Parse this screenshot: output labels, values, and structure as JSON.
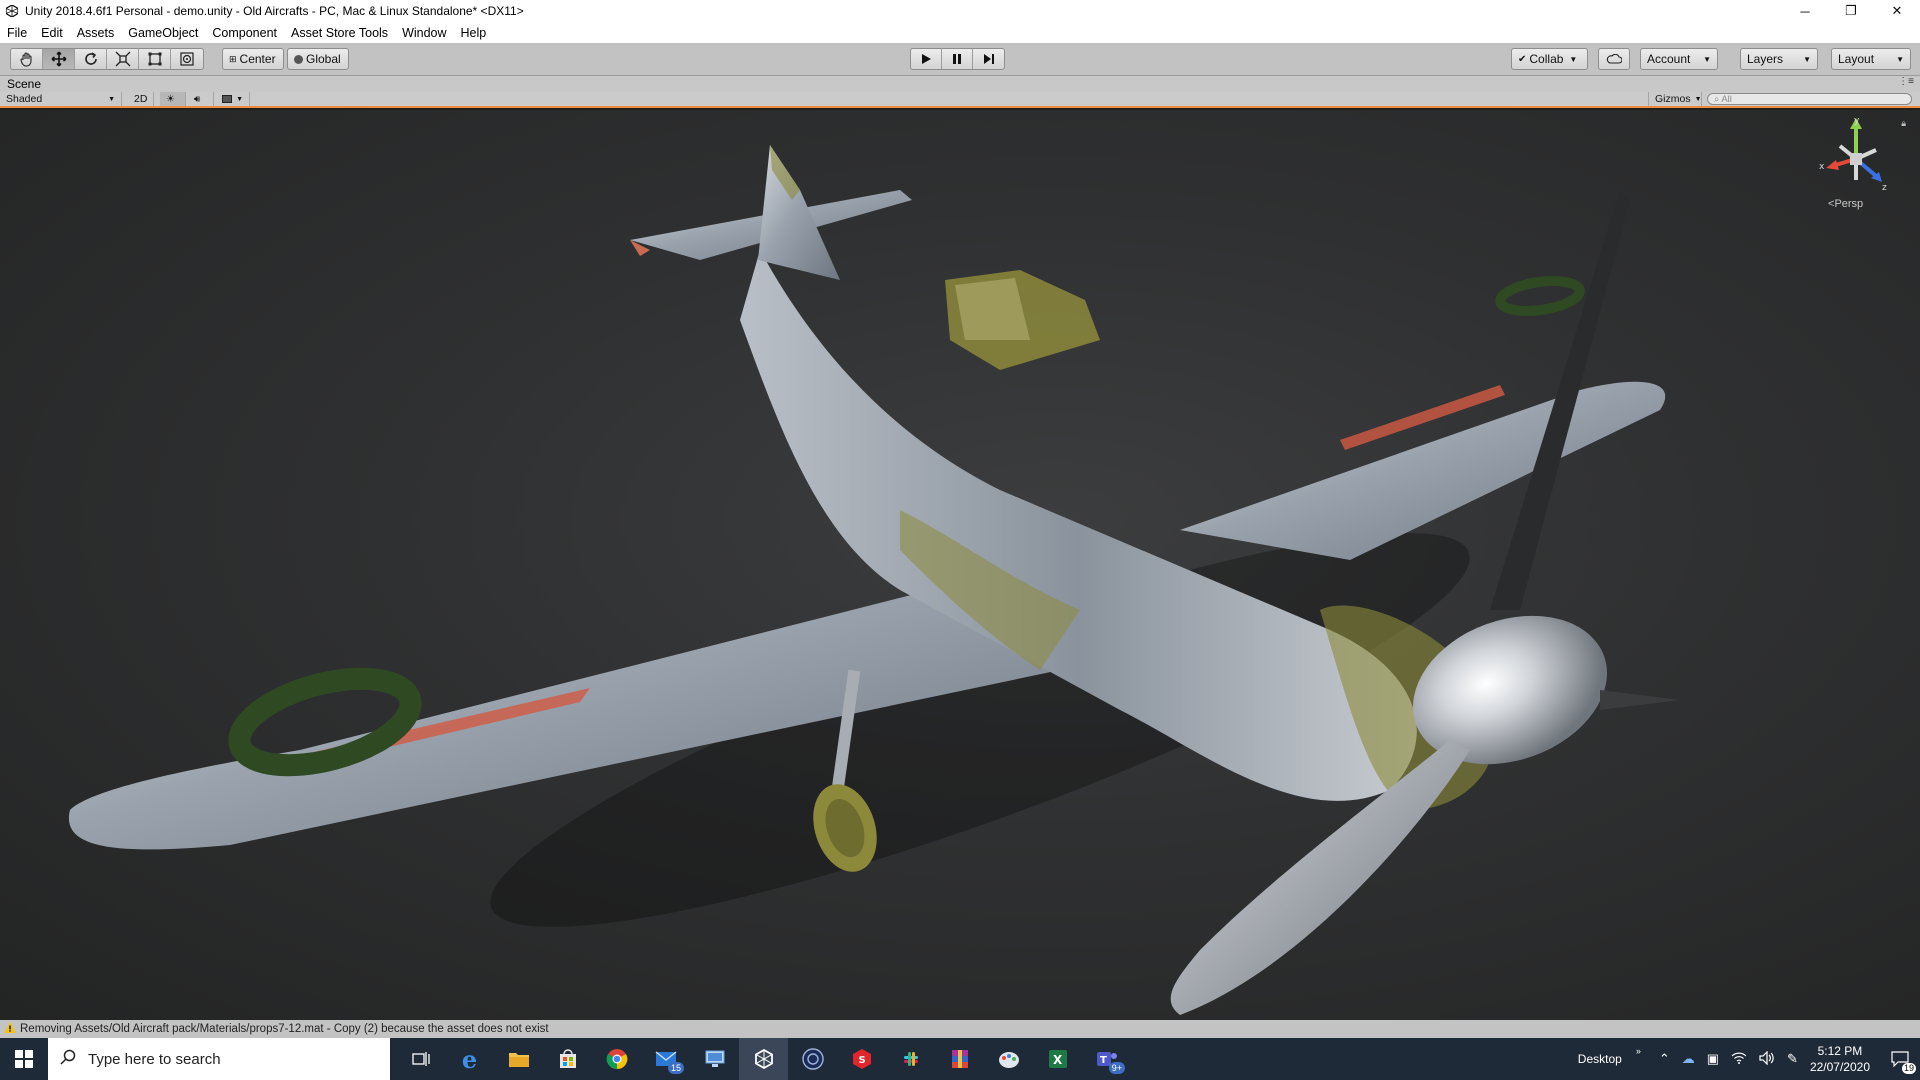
{
  "window": {
    "title": "Unity 2018.4.6f1 Personal - demo.unity - Old Aircrafts - PC, Mac & Linux Standalone* <DX11>",
    "minimize_glyph": "─",
    "restore_glyph": "❐",
    "close_glyph": "✕"
  },
  "menu": [
    "File",
    "Edit",
    "Assets",
    "GameObject",
    "Component",
    "Asset Store Tools",
    "Window",
    "Help"
  ],
  "toolbar": {
    "tools": [
      "hand-tool-icon",
      "move-tool-icon",
      "rotate-tool-icon",
      "scale-tool-icon",
      "rect-tool-icon",
      "transform-tool-icon"
    ],
    "pivot_label": "Center",
    "space_label": "Global",
    "collab_label": "Collab",
    "account_label": "Account",
    "layers_label": "Layers",
    "layout_label": "Layout"
  },
  "scene": {
    "tab_label": "Scene",
    "shading_mode": "Shaded",
    "mode_2d": "2D",
    "gizmos_label": "Gizmos",
    "search_placeholder": "All",
    "projection_label": "Persp",
    "axis_x": "x",
    "axis_y": "y",
    "axis_z": "z"
  },
  "status": {
    "message": "Removing Assets/Old Aircraft pack/Materials/props7-12.mat - Copy (2) because the asset does not exist"
  },
  "taskbar": {
    "search_placeholder": "Type here to search",
    "mail_badge": "15",
    "teams_badge": "9+",
    "desktop_label": "Desktop",
    "time": "5:12 PM",
    "date": "22/07/2020",
    "notification_count": "19"
  },
  "colors": {
    "accent_orange": "#f08a3c",
    "toolbar_bg": "#c2c2c2",
    "viewport_bg": "#2f3031",
    "taskbar_bg": "#1f2a38"
  }
}
